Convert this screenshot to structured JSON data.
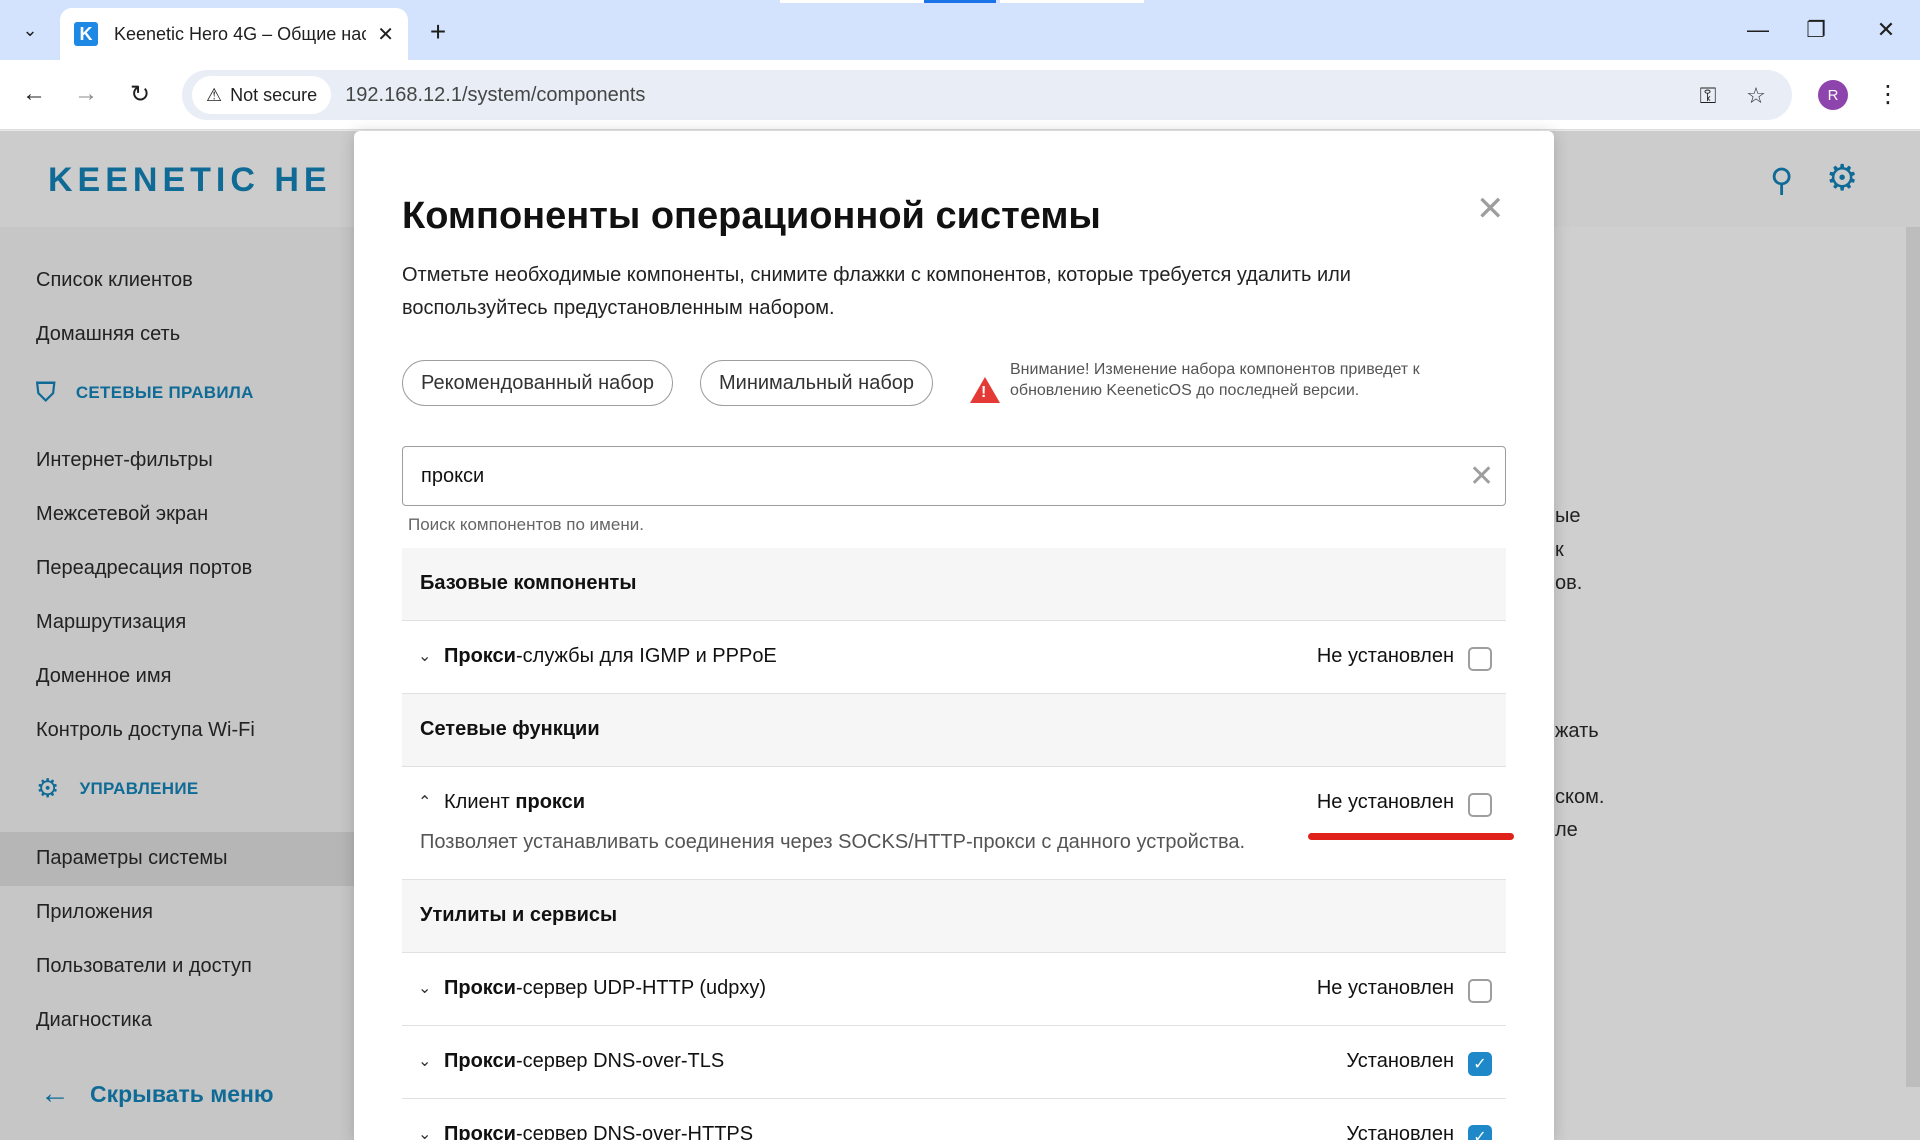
{
  "browser": {
    "tab_title": "Keenetic Hero 4G – Общие нас",
    "tab_favicon": "K",
    "tab_dropdown_icon": "⌄",
    "new_tab_icon": "+",
    "not_secure": "Not secure",
    "url": "192.168.12.1/system/components",
    "profile_initial": "R",
    "icons": [
      "back-icon",
      "forward-icon",
      "reload-icon",
      "warning-icon",
      "key-icon",
      "star-icon",
      "kebab-icon",
      "minimize-icon",
      "restore-icon",
      "close-icon"
    ]
  },
  "page": {
    "logo": "KEENETIC HE",
    "sidebar": {
      "items_top": [
        "Список клиентов",
        "Домашняя сеть"
      ],
      "section_network": "СЕТЕВЫЕ ПРАВИЛА",
      "items_network": [
        "Интернет-фильтры",
        "Межсетевой экран",
        "Переадресация портов",
        "Маршрутизация",
        "Доменное имя",
        "Контроль доступа Wi-Fi"
      ],
      "section_manage": "УПРАВЛЕНИЕ",
      "items_manage": [
        "Параметры системы",
        "Приложения",
        "Пользователи и доступ",
        "Диагностика"
      ],
      "hide_menu": "Скрывать меню"
    },
    "right_fragments": [
      "ые",
      "к",
      "ов.",
      "жать",
      "ском.",
      "ле"
    ]
  },
  "modal": {
    "title": "Компоненты операционной системы",
    "description": "Отметьте необходимые компоненты, снимите флажки с компонентов, которые требуется удалить или воспользуйтесь предустановленным набором.",
    "btn_recommended": "Рекомендованный набор",
    "btn_minimal": "Минимальный набор",
    "warning": "Внимание! Изменение набора компонентов приведет к обновлению KeeneticOS до последней версии.",
    "search_value": "прокси",
    "search_hint": "Поиск компонентов по имени.",
    "groups": {
      "basic": "Базовые компоненты",
      "network": "Сетевые функции",
      "utils": "Утилиты и сервисы"
    },
    "components": {
      "igmp": {
        "bold": "Прокси",
        "rest": "-службы для IGMP и PPPoE",
        "status": "Не установлен",
        "checked": false
      },
      "client": {
        "pre": "Клиент ",
        "bold": "прокси",
        "status": "Не установлен",
        "checked": false,
        "description": "Позволяет устанавливать соединения через SOCKS/HTTP-прокси с данного устройства."
      },
      "udpxy": {
        "bold": "Прокси",
        "rest": "-сервер UDP-HTTP (udpxy)",
        "status": "Не установлен",
        "checked": false
      },
      "dot": {
        "bold": "Прокси",
        "rest": "-сервер DNS-over-TLS",
        "status": "Установлен",
        "checked": true
      },
      "doh": {
        "bold": "Прокси",
        "rest": "-сервер DNS-over-HTTPS",
        "status": "Установлен",
        "checked": true
      }
    }
  },
  "colors": {
    "brand": "#0f6b96",
    "check": "#1e88c8",
    "highlight": "#e0201a",
    "tabbar": "#d3e3fd"
  }
}
